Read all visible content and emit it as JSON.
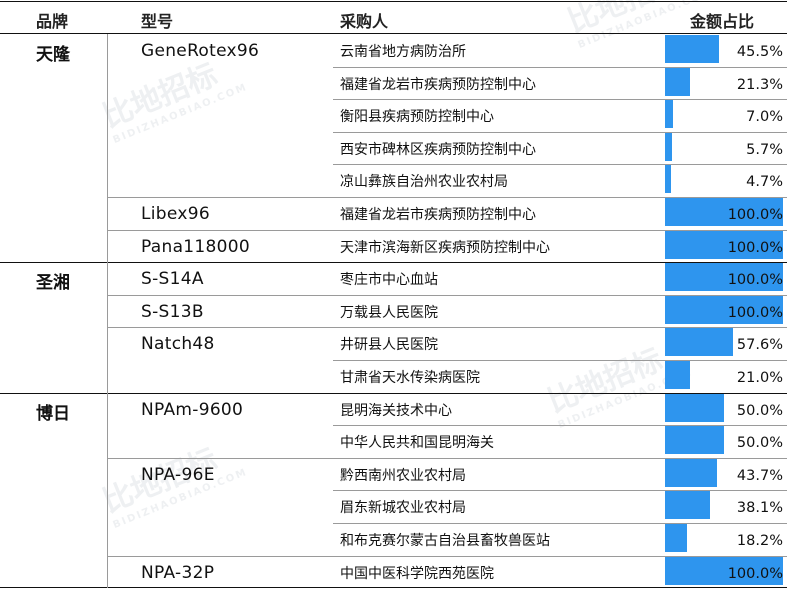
{
  "chart_data": {
    "type": "table",
    "columns": [
      "品牌",
      "型号",
      "采购人",
      "金额占比"
    ],
    "rows": [
      {
        "brand": "天隆",
        "model": "GeneRotex96",
        "buyer": "云南省地方病防治所",
        "value": 45.5,
        "label": "45.5%"
      },
      {
        "brand": "",
        "model": "",
        "buyer": "福建省龙岩市疾病预防控制中心",
        "value": 21.3,
        "label": "21.3%"
      },
      {
        "brand": "",
        "model": "",
        "buyer": "衡阳县疾病预防控制中心",
        "value": 7.0,
        "label": "7.0%"
      },
      {
        "brand": "",
        "model": "",
        "buyer": "西安市碑林区疾病预防控制中心",
        "value": 5.7,
        "label": "5.7%"
      },
      {
        "brand": "",
        "model": "",
        "buyer": "凉山彝族自治州农业农村局",
        "value": 4.7,
        "label": "4.7%"
      },
      {
        "brand": "",
        "model": "Libex96",
        "buyer": "福建省龙岩市疾病预防控制中心",
        "value": 100.0,
        "label": "100.0%"
      },
      {
        "brand": "",
        "model": "Pana118000",
        "buyer": "天津市滨海新区疾病预防控制中心",
        "value": 100.0,
        "label": "100.0%"
      },
      {
        "brand": "圣湘",
        "model": "S-S14A",
        "buyer": "枣庄市中心血站",
        "value": 100.0,
        "label": "100.0%"
      },
      {
        "brand": "",
        "model": "S-S13B",
        "buyer": "万载县人民医院",
        "value": 100.0,
        "label": "100.0%"
      },
      {
        "brand": "",
        "model": "Natch48",
        "buyer": "井研县人民医院",
        "value": 57.6,
        "label": "57.6%"
      },
      {
        "brand": "",
        "model": "",
        "buyer": "甘肃省天水传染病医院",
        "value": 21.0,
        "label": "21.0%"
      },
      {
        "brand": "博日",
        "model": "NPAm-9600",
        "buyer": "昆明海关技术中心",
        "value": 50.0,
        "label": "50.0%"
      },
      {
        "brand": "",
        "model": "",
        "buyer": "中华人民共和国昆明海关",
        "value": 50.0,
        "label": "50.0%"
      },
      {
        "brand": "",
        "model": "NPA-96E",
        "buyer": "黔西南州农业农村局",
        "value": 43.7,
        "label": "43.7%"
      },
      {
        "brand": "",
        "model": "",
        "buyer": "眉东新城农业农村局",
        "value": 38.1,
        "label": "38.1%"
      },
      {
        "brand": "",
        "model": "",
        "buyer": "和布克赛尔蒙古自治县畜牧兽医站",
        "value": 18.2,
        "label": "18.2%"
      },
      {
        "brand": "",
        "model": "NPA-32P",
        "buyer": "中国中医科学院西苑医院",
        "value": 100.0,
        "label": "100.0%"
      }
    ],
    "bar_color": "#2e95ee",
    "xlim": [
      0,
      100
    ]
  },
  "watermark": {
    "text": "比地招标",
    "subtext": "BIDIZHAOBIAO.COM"
  }
}
